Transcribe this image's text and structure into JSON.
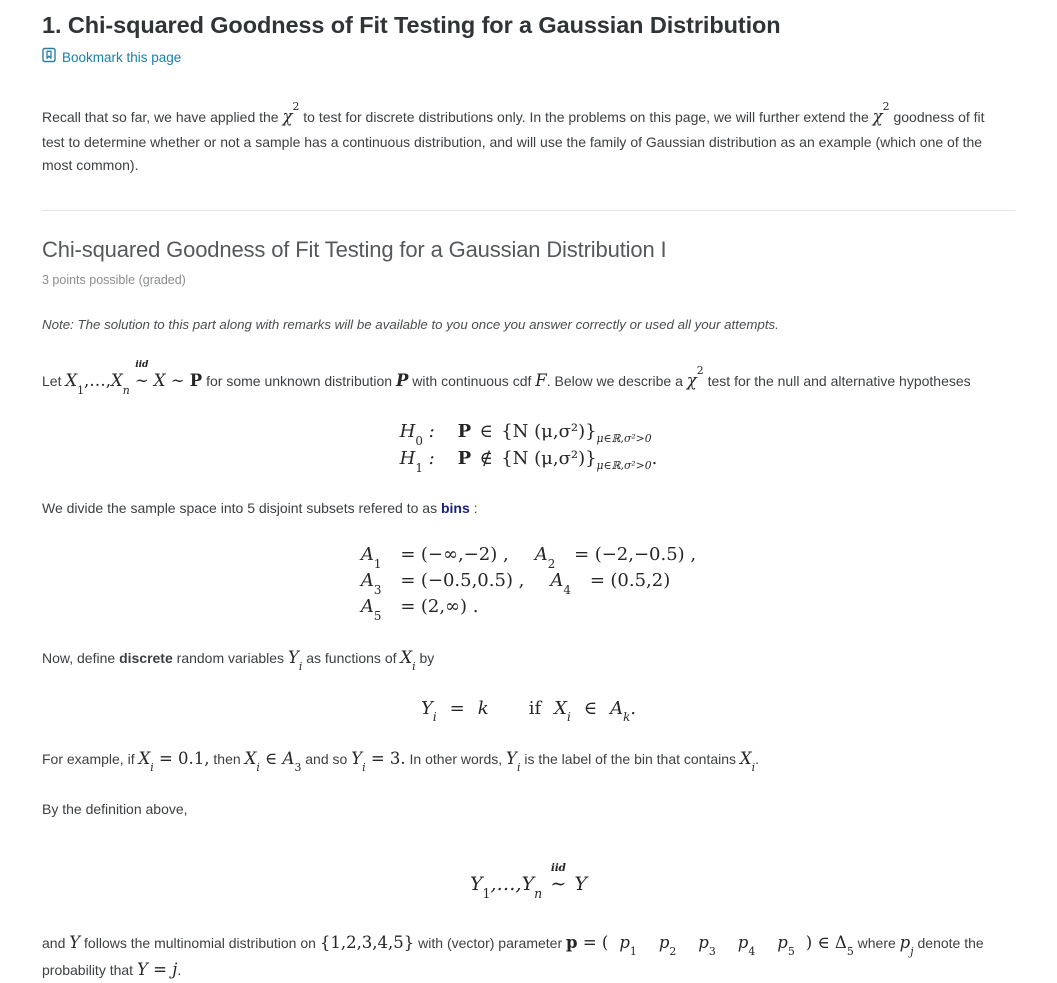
{
  "header": {
    "title": "1. Chi-squared Goodness of Fit Testing for a Gaussian Distribution",
    "bookmark_label": "Bookmark this page",
    "bookmark_icon": "bookmark-icon",
    "link_color": "#1b7fa8"
  },
  "intro": {
    "part1": "Recall that so far, we have applied the ",
    "chi": "χ",
    "chi_exp": "2",
    "part2": " to test for discrete distributions only. In the problems on this page, we will further extend the ",
    "part3": " goodness of fit test to determine whether or not a sample has a continuous distribution, and will use the family of Gaussian distribution as an example (which one of the most common)."
  },
  "section": {
    "title": "Chi-squared Goodness of Fit Testing for a Gaussian Distribution I",
    "points": "3 points possible (graded)",
    "note": "Note: The solution to this part along with remarks will be available to you once you answer correctly or used all your attempts."
  },
  "setup": {
    "let_prefix": "Let ",
    "X_sym": "X",
    "X_sub1": "1",
    "ellipsis": ",…,",
    "X_subn": "n",
    "iid_label": "iid",
    "tilde": "∼",
    "P_sym": "P",
    "text_after_P": " for some unknown distribution ",
    "text_with_cdf": " with continuous cdf ",
    "F_sym": "F",
    "text_below": ". Below we describe a ",
    "text_test": " test for the null and alternative hypotheses"
  },
  "hypotheses": [
    {
      "name": "H",
      "index": "0",
      "colon": ":",
      "prob": "P",
      "relation": "∈",
      "set": "{N (μ,σ²)}",
      "condition_mu": "μ∈ℝ,",
      "condition_sigma": "σ²>0",
      "trailer": ""
    },
    {
      "name": "H",
      "index": "1",
      "colon": ":",
      "prob": "P",
      "relation": "∉",
      "set": "{N (μ,σ²)}",
      "condition_mu": "μ∈ℝ,",
      "condition_sigma": "σ²>0",
      "trailer": "."
    }
  ],
  "bins_intro": {
    "text_before": "We divide the sample space into 5 disjoint subsets refered to as ",
    "keyword": "bins",
    "keyword_color": "#1a237e",
    "text_after": " :"
  },
  "bins": [
    {
      "name": "A",
      "index": "1",
      "eq": "=",
      "value": "(−∞,−2) ,",
      "row": 0,
      "col": 0
    },
    {
      "name": "A",
      "index": "2",
      "eq": "=",
      "value": "(−2,−0.5) ,",
      "row": 0,
      "col": 1
    },
    {
      "name": "A",
      "index": "3",
      "eq": "=",
      "value": "(−0.5,0.5) ,",
      "row": 1,
      "col": 0
    },
    {
      "name": "A",
      "index": "4",
      "eq": "=",
      "value": "(0.5,2)",
      "row": 1,
      "col": 1
    },
    {
      "name": "A",
      "index": "5",
      "eq": "=",
      "value": "(2,∞) .",
      "row": 2,
      "col": 0
    }
  ],
  "define": {
    "before": "Now, define ",
    "bold_word": "discrete",
    "middle": " random variables ",
    "Y_sym": "Y",
    "Y_sub": "i",
    "after": " as functions of ",
    "X_sym": "X",
    "X_sub": "i",
    "tail": " by"
  },
  "yk_formula": {
    "Y": "Y",
    "Y_sub": "i",
    "eq": "=",
    "k": "k",
    "if": "if",
    "X": "X",
    "X_sub": "i",
    "in": "∈",
    "A": "A",
    "A_sub": "k",
    "period": "."
  },
  "example": {
    "s1": "For example, if ",
    "m1": "X",
    "m1sub": "i",
    "m1eq": "= 0.1,",
    "s2": " then ",
    "m2": "X",
    "m2sub": "i",
    "m2in": "∈",
    "m2A": "A",
    "m2Asub": "3",
    "s3": " and so ",
    "m3": "Y",
    "m3sub": "i",
    "m3eq": "= 3.",
    "s4": " In other words, ",
    "m4": "Y",
    "m4sub": "i",
    "s5": " is the label of the bin that contains ",
    "m5": "X",
    "m5sub": "i",
    "s6": "."
  },
  "by_definition": "By the definition above,",
  "iid_Y": {
    "Y": "Y",
    "sub1": "1",
    "ellipsis": ",…,",
    "Yn": "Y",
    "subn": "n",
    "iid_label": "iid",
    "tilde": "∼",
    "Yr": "Y"
  },
  "final": {
    "s1": "and ",
    "Y": "Y",
    "s2": " follows the multinomial distribution on ",
    "set": "{1,2,3,4,5}",
    "s3": " with (vector) parameter ",
    "p_bold": "p",
    "eq": "=",
    "lparen": "(",
    "components": [
      "p",
      "p",
      "p",
      "p",
      "p"
    ],
    "component_subs": [
      "1",
      "2",
      "3",
      "4",
      "5"
    ],
    "rparen": ")",
    "in": "∈",
    "delta": "Δ",
    "delta_sub": "5",
    "s4": " where ",
    "pj": "p",
    "pj_sub": "j",
    "s5": " denote the probability that ",
    "Yj": "Y",
    "eq2": "=",
    "j": "j",
    "s6": "."
  }
}
